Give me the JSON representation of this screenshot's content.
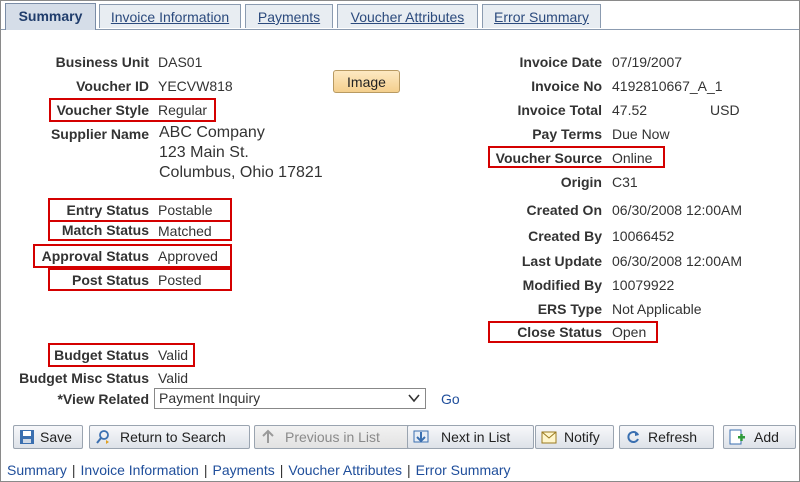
{
  "tabs": [
    {
      "label": "Summary",
      "active": true
    },
    {
      "label": "Invoice Information"
    },
    {
      "label": "Payments"
    },
    {
      "label": "Voucher Attributes"
    },
    {
      "label": "Error Summary"
    }
  ],
  "left_fields": {
    "business_unit": {
      "label": "Business Unit",
      "value": "DAS01"
    },
    "voucher_id": {
      "label": "Voucher ID",
      "value": "YECVW818"
    },
    "voucher_style": {
      "label": "Voucher Style",
      "value": "Regular"
    },
    "supplier_name": {
      "label": "Supplier Name",
      "line1": "ABC Company",
      "line2": "123 Main St.",
      "line3": "Columbus, Ohio 17821"
    },
    "entry_status": {
      "label": "Entry Status",
      "value": "Postable"
    },
    "match_status": {
      "label": "Match Status",
      "value": "Matched"
    },
    "approval_status": {
      "label": "Approval Status",
      "value": "Approved"
    },
    "post_status": {
      "label": "Post Status",
      "value": "Posted"
    },
    "budget_status": {
      "label": "Budget Status",
      "value": "Valid"
    },
    "budget_misc_status": {
      "label": "Budget Misc Status",
      "value": "Valid"
    },
    "view_related": {
      "label": "*View Related",
      "selected": "Payment Inquiry"
    }
  },
  "image_button": "Image",
  "go_link": "Go",
  "right_fields": {
    "invoice_date": {
      "label": "Invoice Date",
      "value": "07/19/2007"
    },
    "invoice_no": {
      "label": "Invoice No",
      "value": "4192810667_A_1"
    },
    "invoice_total": {
      "label": "Invoice Total",
      "value": "47.52",
      "currency": "USD"
    },
    "pay_terms": {
      "label": "Pay Terms",
      "value": "Due Now"
    },
    "voucher_source": {
      "label": "Voucher Source",
      "value": "Online"
    },
    "origin": {
      "label": "Origin",
      "value": "C31"
    },
    "created_on": {
      "label": "Created On",
      "value": "06/30/2008 12:00AM"
    },
    "created_by": {
      "label": "Created By",
      "value": "10066452"
    },
    "last_update": {
      "label": "Last Update",
      "value": "06/30/2008 12:00AM"
    },
    "modified_by": {
      "label": "Modified By",
      "value": "10079922"
    },
    "ers_type": {
      "label": "ERS Type",
      "value": "Not Applicable"
    },
    "close_status": {
      "label": "Close Status",
      "value": "Open"
    }
  },
  "toolbar": {
    "save": "Save",
    "return_to_search": "Return to Search",
    "previous_in_list": "Previous in List",
    "next_in_list": "Next in List",
    "notify": "Notify",
    "refresh": "Refresh",
    "add": "Add"
  },
  "bottom_links": [
    "Summary",
    "Invoice Information",
    "Payments",
    "Voucher Attributes",
    "Error Summary"
  ],
  "colors": {
    "highlight_box": "#d40000",
    "link": "#1f4e9b",
    "tab_active": "#d5dde8"
  }
}
